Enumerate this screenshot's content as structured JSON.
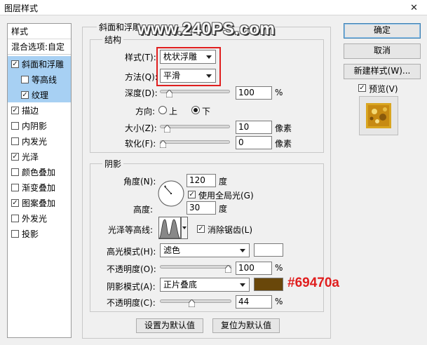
{
  "window": {
    "title": "图层样式",
    "close_glyph": "✕"
  },
  "watermark": "www.240PS.com",
  "left_panel": {
    "header": "样式",
    "blend_options": "混合选项:自定",
    "items": [
      {
        "label": "斜面和浮雕",
        "checked": true,
        "selected": true,
        "indent": false
      },
      {
        "label": "等高线",
        "checked": false,
        "selected": true,
        "indent": true
      },
      {
        "label": "纹理",
        "checked": true,
        "selected": true,
        "indent": true
      },
      {
        "label": "描边",
        "checked": true,
        "selected": false,
        "indent": false
      },
      {
        "label": "内阴影",
        "checked": false,
        "selected": false,
        "indent": false
      },
      {
        "label": "内发光",
        "checked": false,
        "selected": false,
        "indent": false
      },
      {
        "label": "光泽",
        "checked": true,
        "selected": false,
        "indent": false
      },
      {
        "label": "颜色叠加",
        "checked": false,
        "selected": false,
        "indent": false
      },
      {
        "label": "渐变叠加",
        "checked": false,
        "selected": false,
        "indent": false
      },
      {
        "label": "图案叠加",
        "checked": true,
        "selected": false,
        "indent": false
      },
      {
        "label": "外发光",
        "checked": false,
        "selected": false,
        "indent": false
      },
      {
        "label": "投影",
        "checked": false,
        "selected": false,
        "indent": false
      }
    ]
  },
  "bevel": {
    "title": "斜面和浮雕",
    "structure": {
      "title": "结构",
      "style_label": "样式(T):",
      "style_value": "枕状浮雕",
      "technique_label": "方法(Q):",
      "technique_value": "平滑",
      "depth_label": "深度(D):",
      "depth_value": "100",
      "depth_unit": "%",
      "depth_level": 0.1,
      "direction_label": "方向:",
      "direction_up": "上",
      "direction_down": "下",
      "direction_selected": "down",
      "size_label": "大小(Z):",
      "size_value": "10",
      "size_unit": "像素",
      "size_level": 0.07,
      "soften_label": "软化(F):",
      "soften_value": "0",
      "soften_unit": "像素",
      "soften_level": 0.0
    },
    "shading": {
      "title": "阴影",
      "angle_label": "角度(N):",
      "angle_value": "120",
      "angle_unit": "度",
      "global_light_label": "使用全局光(G)",
      "global_light_checked": true,
      "altitude_label": "高度:",
      "altitude_value": "30",
      "altitude_unit": "度",
      "gloss_contour_label": "光泽等高线:",
      "antialias_label": "消除锯齿(L)",
      "antialias_checked": true,
      "highlight_mode_label": "高光模式(H):",
      "highlight_mode_value": "滤色",
      "highlight_color": "#ffffff",
      "highlight_opacity_label": "不透明度(O):",
      "highlight_opacity_value": "100",
      "highlight_opacity_unit": "%",
      "highlight_opacity_level": 1.0,
      "shadow_mode_label": "阴影模式(A):",
      "shadow_mode_value": "正片叠底",
      "shadow_color": "#69470a",
      "shadow_color_annotation": "#69470a",
      "shadow_opacity_label": "不透明度(C):",
      "shadow_opacity_value": "44",
      "shadow_opacity_unit": "%",
      "shadow_opacity_level": 0.44
    },
    "make_default": "设置为默认值",
    "reset_default": "复位为默认值"
  },
  "right_panel": {
    "ok": "确定",
    "cancel": "取消",
    "new_style": "新建样式(W)...",
    "preview_label": "预览(V)",
    "preview_checked": true
  },
  "colors": {
    "selection": "#a7d0f3",
    "annotation_red": "#e01e1e"
  }
}
